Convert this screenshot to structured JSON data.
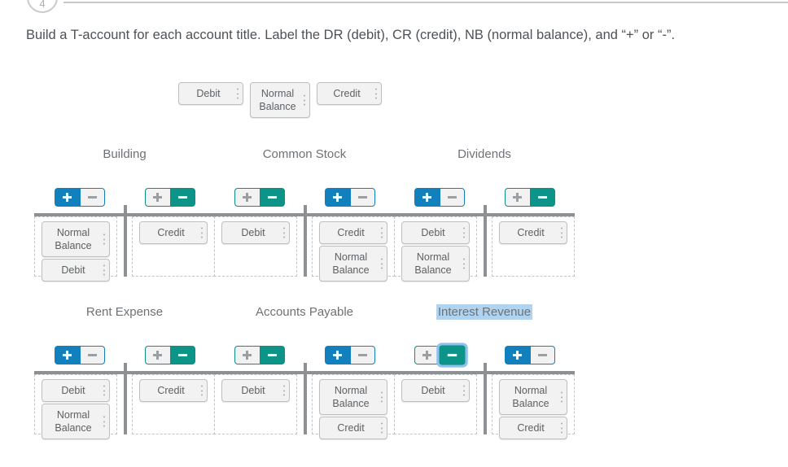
{
  "question": {
    "number": "4",
    "prompt": "Build a T-account for each account title. Label the DR (debit), CR (credit), NB (normal balance), and “+” or “-”."
  },
  "palette": {
    "chips": [
      {
        "label": "Debit",
        "size": "w-debit"
      },
      {
        "label": "Normal Balance",
        "size": "w-nb"
      },
      {
        "label": "Credit",
        "size": "w-credit"
      }
    ]
  },
  "colors": {
    "blue": "#1180bd",
    "teal": "#0d9488",
    "focus_ring": "#8cc2ec",
    "selection_highlight": "#b0d3ef",
    "t_bar": "#8d9194",
    "chip_bg": "#f2f2f2",
    "chip_border": "#bfbfbf",
    "dropzone_border": "#c4c4c4",
    "text": "#5c6165"
  },
  "icons": {
    "plus": "plus-icon",
    "minus": "minus-icon",
    "grip": "drag-grip-icon"
  },
  "accounts": [
    {
      "title": "Building",
      "title_selected": false,
      "debit_side": {
        "toggle_theme": "blue",
        "plus_state": "on",
        "minus_state": "off",
        "plus_label": "+",
        "minus_label": "−",
        "chips": [
          {
            "label": "Normal Balance",
            "size": "w-nb"
          },
          {
            "label": "Debit",
            "size": "w-debit"
          }
        ]
      },
      "credit_side": {
        "toggle_theme": "teal",
        "plus_state": "off",
        "minus_state": "on",
        "plus_label": "+",
        "minus_label": "−",
        "chips": [
          {
            "label": "Credit",
            "size": "w-credit"
          }
        ]
      }
    },
    {
      "title": "Common Stock",
      "title_selected": false,
      "debit_side": {
        "toggle_theme": "teal",
        "plus_state": "off",
        "minus_state": "on",
        "plus_label": "+",
        "minus_label": "−",
        "chips": [
          {
            "label": "Debit",
            "size": "w-debit"
          }
        ]
      },
      "credit_side": {
        "toggle_theme": "blue",
        "plus_state": "on",
        "minus_state": "off",
        "plus_label": "+",
        "minus_label": "−",
        "chips": [
          {
            "label": "Credit",
            "size": "w-credit"
          },
          {
            "label": "Normal Balance",
            "size": "w-nb"
          }
        ]
      }
    },
    {
      "title": "Dividends",
      "title_selected": false,
      "debit_side": {
        "toggle_theme": "blue",
        "plus_state": "on",
        "minus_state": "off",
        "plus_label": "+",
        "minus_label": "−",
        "chips": [
          {
            "label": "Debit",
            "size": "w-debit"
          },
          {
            "label": "Normal Balance",
            "size": "w-nb"
          }
        ]
      },
      "credit_side": {
        "toggle_theme": "teal",
        "plus_state": "off",
        "minus_state": "on",
        "plus_label": "+",
        "minus_label": "−",
        "chips": [
          {
            "label": "Credit",
            "size": "w-credit"
          }
        ]
      }
    },
    {
      "title": "Rent Expense",
      "title_selected": false,
      "debit_side": {
        "toggle_theme": "blue",
        "plus_state": "on",
        "minus_state": "off",
        "plus_label": "+",
        "minus_label": "−",
        "chips": [
          {
            "label": "Debit",
            "size": "w-debit"
          },
          {
            "label": "Normal Balance",
            "size": "w-nb"
          }
        ]
      },
      "credit_side": {
        "toggle_theme": "teal",
        "plus_state": "off",
        "minus_state": "on",
        "plus_label": "+",
        "minus_label": "−",
        "chips": [
          {
            "label": "Credit",
            "size": "w-credit"
          }
        ]
      }
    },
    {
      "title": "Accounts Payable",
      "title_selected": false,
      "debit_side": {
        "toggle_theme": "teal",
        "plus_state": "off",
        "minus_state": "on",
        "plus_label": "+",
        "minus_label": "−",
        "chips": [
          {
            "label": "Debit",
            "size": "w-debit"
          }
        ]
      },
      "credit_side": {
        "toggle_theme": "blue",
        "plus_state": "on",
        "minus_state": "off",
        "plus_label": "+",
        "minus_label": "−",
        "chips": [
          {
            "label": "Normal Balance",
            "size": "w-nb"
          },
          {
            "label": "Credit",
            "size": "w-credit"
          }
        ]
      }
    },
    {
      "title": "Interest Revenue",
      "title_selected": true,
      "debit_side": {
        "toggle_theme": "teal",
        "plus_state": "off",
        "minus_state": "on",
        "minus_focused": true,
        "plus_label": "+",
        "minus_label": "−",
        "chips": [
          {
            "label": "Debit",
            "size": "w-debit"
          }
        ]
      },
      "credit_side": {
        "toggle_theme": "blue",
        "plus_state": "on",
        "minus_state": "off",
        "plus_label": "+",
        "minus_label": "−",
        "chips": [
          {
            "label": "Normal Balance",
            "size": "w-nb"
          },
          {
            "label": "Credit",
            "size": "w-credit"
          }
        ]
      }
    }
  ]
}
